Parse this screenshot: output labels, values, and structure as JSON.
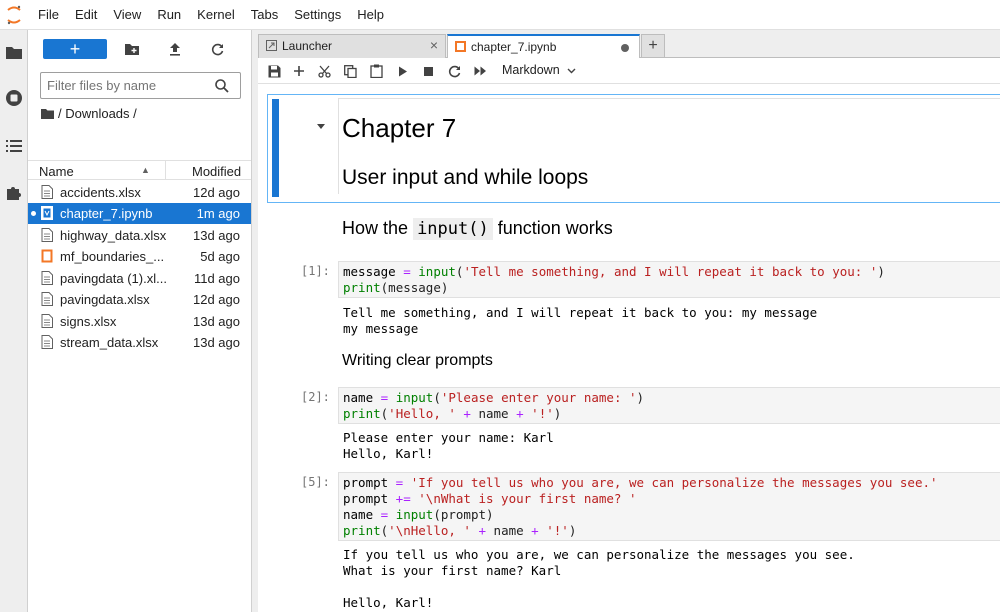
{
  "menu": {
    "logo_icon": "jupyter-logo-icon",
    "items": [
      "File",
      "Edit",
      "View",
      "Run",
      "Kernel",
      "Tabs",
      "Settings",
      "Help"
    ]
  },
  "sidebar_icons": [
    "folder-icon",
    "running-icon",
    "toc-icon",
    "extension-icon"
  ],
  "filebrowser": {
    "new_label": "+",
    "search_placeholder": "Filter files by name",
    "breadcrumb": "/ Downloads /",
    "col_name": "Name",
    "col_modified": "Modified",
    "sort_glyph": "▲",
    "files": [
      {
        "name": "accidents.xlsx",
        "modified": "12d ago",
        "icon": "file-icon",
        "selected": false
      },
      {
        "name": "chapter_7.ipynb",
        "modified": "1m ago",
        "icon": "notebook-icon",
        "selected": true
      },
      {
        "name": "highway_data.xlsx",
        "modified": "13d ago",
        "icon": "file-icon",
        "selected": false
      },
      {
        "name": "mf_boundaries_...",
        "modified": "5d ago",
        "icon": "notebook-icon",
        "selected": false
      },
      {
        "name": "pavingdata (1).xl...",
        "modified": "11d ago",
        "icon": "file-icon",
        "selected": false
      },
      {
        "name": "pavingdata.xlsx",
        "modified": "12d ago",
        "icon": "file-icon",
        "selected": false
      },
      {
        "name": "signs.xlsx",
        "modified": "13d ago",
        "icon": "file-icon",
        "selected": false
      },
      {
        "name": "stream_data.xlsx",
        "modified": "13d ago",
        "icon": "file-icon",
        "selected": false
      }
    ]
  },
  "tabs": [
    {
      "label": "Launcher",
      "close": "×"
    },
    {
      "label": "chapter_7.ipynb"
    }
  ],
  "tab_add": "+",
  "toolbar": {
    "cell_type": "Markdown",
    "chevron": "⌄"
  },
  "notebook": {
    "h1": "Chapter 7",
    "h2": "User input and while loops",
    "h2b_pre": "How the",
    "h2b_code": "input()",
    "h2b_post": "function works",
    "h3": "Writing clear prompts",
    "cells": [
      {
        "prompt": "[1]:",
        "output": "Tell me something, and I will repeat it back to you: my message\nmy message"
      },
      {
        "prompt": "[2]:",
        "output": "Please enter your name: Karl\nHello, Karl!"
      },
      {
        "prompt": "[5]:",
        "output": "If you tell us who you are, we can personalize the messages you see.\nWhat is your first name? Karl\n\nHello, Karl!"
      }
    ],
    "code": {
      "c1": {
        "l1a": "message",
        "l1b": " = ",
        "l1c": "input",
        "l1d": "(",
        "l1e": "'Tell me something, and I will repeat it back to you: '",
        "l1f": ")",
        "l2a": "print",
        "l2b": "(message)"
      },
      "c2": {
        "l1a": "name",
        "l1b": " = ",
        "l1c": "input",
        "l1d": "(",
        "l1e": "'Please enter your name: '",
        "l1f": ")",
        "l2a": "print",
        "l2b": "(",
        "l2c": "'Hello, '",
        "l2d": " + ",
        "l2e": "name",
        "l2f": " + ",
        "l2g": "'!'",
        "l2h": ")"
      },
      "c5": {
        "l1a": "prompt",
        "l1b": " = ",
        "l1c": "'If you tell us who you are, we can personalize the messages you see.'",
        "l2a": "prompt",
        "l2b": " += ",
        "l2c": "'\\nWhat is your first name? '",
        "l3a": "name",
        "l3b": " = ",
        "l3c": "input",
        "l3d": "(prompt)",
        "l4a": "print",
        "l4b": "(",
        "l4c": "'\\nHello, '",
        "l4d": " + ",
        "l4e": "name",
        "l4f": " + ",
        "l4g": "'!'",
        "l4h": ")"
      }
    }
  },
  "colors": {
    "accent": "#1976d2",
    "orange": "#f37726"
  }
}
